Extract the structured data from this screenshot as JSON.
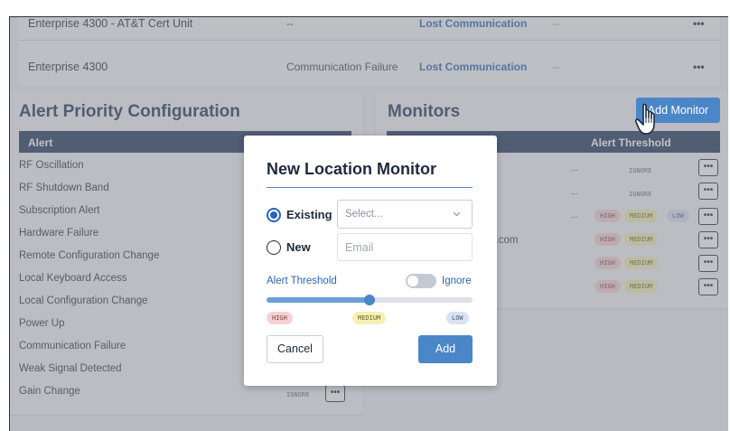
{
  "devices": [
    {
      "name": "Enterprise 4300 - AT&T Cert Unit",
      "failure": "--",
      "status": "Lost Communication",
      "extra": "--",
      "more": "•••"
    },
    {
      "name": "Enterprise 4300",
      "failure": "Communication Failure",
      "status": "Lost Communication",
      "extra": "--",
      "more": "•••"
    }
  ],
  "alert_config": {
    "title": "Alert Priority Configuration",
    "header": "Alert",
    "items": [
      "RF Oscillation",
      "RF Shutdown Band",
      "Subscription Alert",
      "Hardware Failure",
      "Remote Configuration Change",
      "Local Keyboard Access",
      "Local Configuration Change",
      "Power Up",
      "Communication Failure",
      "Weak Signal Detected",
      "Gain Change"
    ],
    "last_row_level": "IGNORE",
    "more": "•••"
  },
  "monitors": {
    "title": "Monitors",
    "add_button": "Add Monitor",
    "threshold_header": "Alert Threshold",
    "email_fragment": "cs.com",
    "rows": [
      {
        "dash": "...",
        "levels": [
          "IGNORE"
        ]
      },
      {
        "dash": "...",
        "levels": [
          "IGNORE"
        ]
      },
      {
        "dash": "...",
        "levels": [
          "HIGH",
          "MEDIUM",
          "LOW"
        ]
      },
      {
        "dash": "",
        "levels": [
          "HIGH",
          "MEDIUM"
        ]
      },
      {
        "dash": "",
        "levels": [
          "HIGH",
          "MEDIUM"
        ]
      },
      {
        "dash": "",
        "levels": [
          "HIGH",
          "MEDIUM"
        ]
      }
    ],
    "more": "•••"
  },
  "modal": {
    "title": "New Location Monitor",
    "existing_label": "Existing",
    "select_placeholder": "Select...",
    "new_label": "New",
    "email_placeholder": "Email",
    "threshold_label": "Alert Threshold",
    "ignore_label": "Ignore",
    "ignore_on": false,
    "slider_value": "MEDIUM",
    "slider_levels": [
      "HIGH",
      "MEDIUM",
      "LOW"
    ],
    "cancel_label": "Cancel",
    "add_label": "Add"
  },
  "colors": {
    "accent": "#4a86c8",
    "navy": "#1f3559",
    "link": "#2a64b5",
    "high": "#f6d2d3",
    "medium": "#f5f0b4",
    "low": "#d9e2f1"
  }
}
